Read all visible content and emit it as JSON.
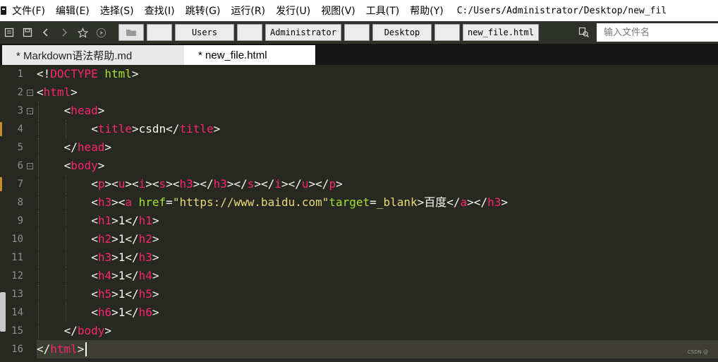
{
  "menu": {
    "items": [
      "文件(F)",
      "编辑(E)",
      "选择(S)",
      "查找(I)",
      "跳转(G)",
      "运行(R)",
      "发行(U)",
      "视图(V)",
      "工具(T)",
      "帮助(Y)"
    ],
    "title_path": "C:/Users/Administrator/Desktop/new_fil"
  },
  "toolbar": {
    "icons": [
      "save-list-icon",
      "save-icon",
      "back-icon",
      "forward-icon",
      "star-icon",
      "play-icon"
    ],
    "breadcrumbs": [
      "Users",
      "Administrator",
      "Desktop",
      "new_file.html"
    ],
    "search_placeholder": "输入文件名"
  },
  "tabs": [
    {
      "label": "* Markdown语法帮助.md",
      "active": false
    },
    {
      "label": "* new_file.html",
      "active": true
    }
  ],
  "editor": {
    "line_numbers": [
      "1",
      "2",
      "3",
      "4",
      "5",
      "6",
      "7",
      "8",
      "9",
      "10",
      "11",
      "12",
      "13",
      "14",
      "15",
      "16"
    ],
    "current_line": 16,
    "lines": [
      {
        "indent": 0,
        "fold": false,
        "marker": false,
        "tokens": [
          [
            "brk",
            "<!"
          ],
          [
            "tag",
            "DOCTYPE"
          ],
          [
            "txt",
            " "
          ],
          [
            "attr",
            "html"
          ],
          [
            "brk",
            ">"
          ]
        ]
      },
      {
        "indent": 0,
        "fold": true,
        "marker": false,
        "tokens": [
          [
            "brk",
            "<"
          ],
          [
            "tag",
            "html"
          ],
          [
            "brk",
            ">"
          ]
        ]
      },
      {
        "indent": 1,
        "fold": true,
        "marker": false,
        "tokens": [
          [
            "brk",
            "<"
          ],
          [
            "tag",
            "head"
          ],
          [
            "brk",
            ">"
          ]
        ]
      },
      {
        "indent": 2,
        "fold": false,
        "marker": true,
        "tokens": [
          [
            "brk",
            "<"
          ],
          [
            "tag",
            "title"
          ],
          [
            "brk",
            ">"
          ],
          [
            "txt",
            "csdn"
          ],
          [
            "brk",
            "</"
          ],
          [
            "tag",
            "title"
          ],
          [
            "brk",
            ">"
          ]
        ]
      },
      {
        "indent": 1,
        "fold": false,
        "marker": false,
        "tokens": [
          [
            "brk",
            "</"
          ],
          [
            "tag",
            "head"
          ],
          [
            "brk",
            ">"
          ]
        ]
      },
      {
        "indent": 1,
        "fold": true,
        "marker": false,
        "tokens": [
          [
            "brk",
            "<"
          ],
          [
            "tag",
            "body"
          ],
          [
            "brk",
            ">"
          ]
        ]
      },
      {
        "indent": 2,
        "fold": false,
        "marker": true,
        "tokens": [
          [
            "brk",
            "<"
          ],
          [
            "tag",
            "p"
          ],
          [
            "brk",
            "><"
          ],
          [
            "tag",
            "u"
          ],
          [
            "brk",
            "><"
          ],
          [
            "tag",
            "i"
          ],
          [
            "brk",
            "><"
          ],
          [
            "tag",
            "s"
          ],
          [
            "brk",
            "><"
          ],
          [
            "tag",
            "h3"
          ],
          [
            "brk",
            "></"
          ],
          [
            "tag",
            "h3"
          ],
          [
            "brk",
            "></"
          ],
          [
            "tag",
            "s"
          ],
          [
            "brk",
            "></"
          ],
          [
            "tag",
            "i"
          ],
          [
            "brk",
            "></"
          ],
          [
            "tag",
            "u"
          ],
          [
            "brk",
            "></"
          ],
          [
            "tag",
            "p"
          ],
          [
            "brk",
            ">"
          ]
        ]
      },
      {
        "indent": 2,
        "fold": false,
        "marker": false,
        "tokens": [
          [
            "brk",
            "<"
          ],
          [
            "tag",
            "h3"
          ],
          [
            "brk",
            "><"
          ],
          [
            "tag",
            "a"
          ],
          [
            "txt",
            " "
          ],
          [
            "attr",
            "href"
          ],
          [
            "txt",
            "="
          ],
          [
            "str",
            "\"https://www.baidu.com\""
          ],
          [
            "attr",
            "target"
          ],
          [
            "txt",
            "="
          ],
          [
            "str",
            "_blank"
          ],
          [
            "brk",
            ">"
          ],
          [
            "txt",
            "百度"
          ],
          [
            "brk",
            "</"
          ],
          [
            "tag",
            "a"
          ],
          [
            "brk",
            "></"
          ],
          [
            "tag",
            "h3"
          ],
          [
            "brk",
            ">"
          ]
        ]
      },
      {
        "indent": 2,
        "fold": false,
        "marker": false,
        "tokens": [
          [
            "brk",
            "<"
          ],
          [
            "tag",
            "h1"
          ],
          [
            "brk",
            ">"
          ],
          [
            "txt",
            "1"
          ],
          [
            "brk",
            "</"
          ],
          [
            "tag",
            "h1"
          ],
          [
            "brk",
            ">"
          ]
        ]
      },
      {
        "indent": 2,
        "fold": false,
        "marker": false,
        "tokens": [
          [
            "brk",
            "<"
          ],
          [
            "tag",
            "h2"
          ],
          [
            "brk",
            ">"
          ],
          [
            "txt",
            "1"
          ],
          [
            "brk",
            "</"
          ],
          [
            "tag",
            "h2"
          ],
          [
            "brk",
            ">"
          ]
        ]
      },
      {
        "indent": 2,
        "fold": false,
        "marker": false,
        "tokens": [
          [
            "brk",
            "<"
          ],
          [
            "tag",
            "h3"
          ],
          [
            "brk",
            ">"
          ],
          [
            "txt",
            "1"
          ],
          [
            "brk",
            "</"
          ],
          [
            "tag",
            "h3"
          ],
          [
            "brk",
            ">"
          ]
        ]
      },
      {
        "indent": 2,
        "fold": false,
        "marker": false,
        "tokens": [
          [
            "brk",
            "<"
          ],
          [
            "tag",
            "h4"
          ],
          [
            "brk",
            ">"
          ],
          [
            "txt",
            "1"
          ],
          [
            "brk",
            "</"
          ],
          [
            "tag",
            "h4"
          ],
          [
            "brk",
            ">"
          ]
        ]
      },
      {
        "indent": 2,
        "fold": false,
        "marker": false,
        "tokens": [
          [
            "brk",
            "<"
          ],
          [
            "tag",
            "h5"
          ],
          [
            "brk",
            ">"
          ],
          [
            "txt",
            "1"
          ],
          [
            "brk",
            "</"
          ],
          [
            "tag",
            "h5"
          ],
          [
            "brk",
            ">"
          ]
        ]
      },
      {
        "indent": 2,
        "fold": false,
        "marker": false,
        "tokens": [
          [
            "brk",
            "<"
          ],
          [
            "tag",
            "h6"
          ],
          [
            "brk",
            ">"
          ],
          [
            "txt",
            "1"
          ],
          [
            "brk",
            "</"
          ],
          [
            "tag",
            "h6"
          ],
          [
            "brk",
            ">"
          ]
        ]
      },
      {
        "indent": 1,
        "fold": false,
        "marker": false,
        "tokens": [
          [
            "brk",
            "</"
          ],
          [
            "tag",
            "body"
          ],
          [
            "brk",
            ">"
          ]
        ]
      },
      {
        "indent": 0,
        "fold": false,
        "marker": false,
        "tokens": [
          [
            "brk",
            "</"
          ],
          [
            "tag",
            "html"
          ],
          [
            "brk",
            ">"
          ]
        ]
      }
    ]
  },
  "watermark": "CSDN @"
}
